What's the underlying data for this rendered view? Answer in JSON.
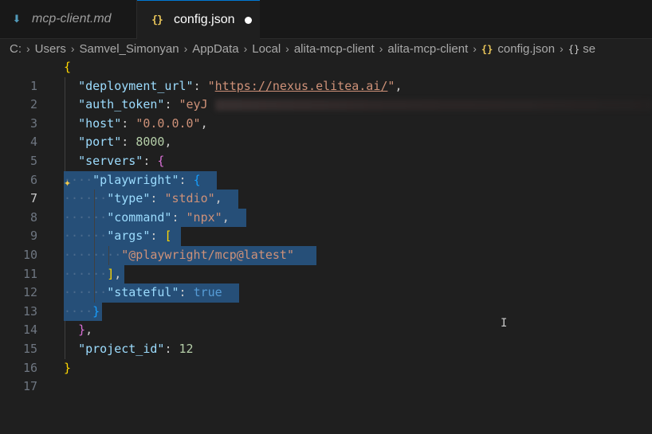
{
  "tabs": [
    {
      "label": "mcp-client.md",
      "icon": "markdown-icon",
      "active": false
    },
    {
      "label": "config.json",
      "icon": "json-icon",
      "icon_glyph": "{}",
      "active": true,
      "dirty": true
    }
  ],
  "breadcrumb": {
    "drive": "C:",
    "segments": [
      "Users",
      "Samvel_Simonyan",
      "AppData",
      "Local",
      "alita-mcp-client",
      "alita-mcp-client"
    ],
    "file": "config.json",
    "file_icon": "{}",
    "symbol_icon": "{}",
    "symbol": "se"
  },
  "editor": {
    "line_numbers": [
      "1",
      "2",
      "3",
      "4",
      "5",
      "6",
      "7",
      "8",
      "9",
      "10",
      "11",
      "12",
      "13",
      "14",
      "15",
      "16",
      "17"
    ],
    "current_line": "7",
    "text": {
      "brace_open": "{",
      "k_deployment_url": "\"deployment_url\"",
      "v_deployment_url": "\"https://nexus.elitea.ai/\"",
      "k_auth_token": "\"auth_token\"",
      "v_auth_token": "\"eyJ",
      "k_host": "\"host\"",
      "v_host": "\"0.0.0.0\"",
      "k_port": "\"port\"",
      "v_port": "8000",
      "k_servers": "\"servers\"",
      "k_playwright": "\"playwright\"",
      "k_type": "\"type\"",
      "v_type": "\"stdio\"",
      "k_command": "\"command\"",
      "v_command": "\"npx\"",
      "k_args": "\"args\"",
      "v_arg0": "\"@playwright/mcp@latest\"",
      "k_stateful": "\"stateful\"",
      "v_stateful": "true",
      "k_project_id": "\"project_id\"",
      "v_project_id": "12",
      "brace_close": "}"
    }
  },
  "colors": {
    "selection": "#264f78",
    "active_tab_border": "#0078d4",
    "json_icon": "#e8c55a"
  }
}
